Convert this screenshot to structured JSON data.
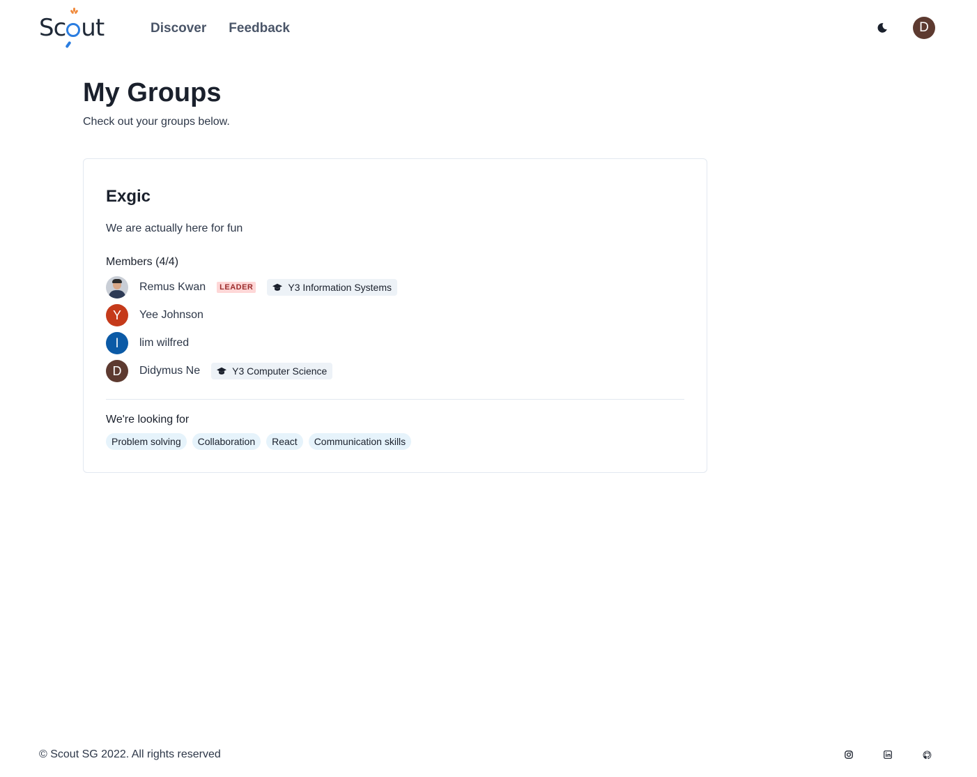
{
  "header": {
    "logo_text_1": "Sc",
    "logo_text_2": "ut",
    "nav": [
      "Discover",
      "Feedback"
    ],
    "user_initial": "D"
  },
  "page": {
    "title": "My Groups",
    "subtitle": "Check out your groups below."
  },
  "group": {
    "name": "Exgic",
    "description": "We are actually here for fun",
    "members_heading": "Members (4/4)",
    "members": [
      {
        "name": "Remus Kwan",
        "initial": "",
        "avatar": "photo",
        "leader": "LEADER",
        "course": "Y3 Information Systems"
      },
      {
        "name": "Yee Johnson",
        "initial": "Y",
        "color": "#c53a1a",
        "leader": "",
        "course": ""
      },
      {
        "name": "lim wilfred",
        "initial": "l",
        "color": "#0b5aa6",
        "leader": "",
        "course": ""
      },
      {
        "name": "Didymus Ne",
        "initial": "D",
        "color": "#5d3a30",
        "leader": "",
        "course": "Y3 Computer Science"
      }
    ],
    "looking_heading": "We're looking for",
    "skills": [
      "Problem solving",
      "Collaboration",
      "React",
      "Communication skills"
    ]
  },
  "footer": {
    "copyright": "© Scout SG 2022. All rights reserved",
    "icons": [
      "instagram-icon",
      "linkedin-icon",
      "github-icon"
    ]
  }
}
